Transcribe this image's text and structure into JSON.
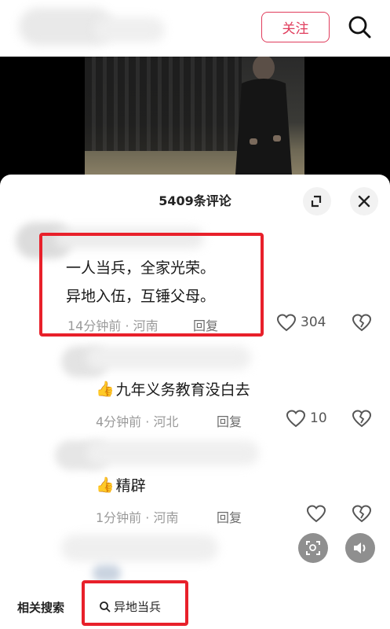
{
  "header": {
    "follow_label": "关注",
    "search_icon": "search-icon"
  },
  "comments_panel": {
    "title": "5409条评论",
    "expand_icon": "expand-icon",
    "close_icon": "close-icon"
  },
  "comments": [
    {
      "text_line1": "一人当兵，全家光荣。",
      "text_line2": "异地入伍，互锤父母。",
      "meta": "14分钟前 · 河南",
      "reply_label": "回复",
      "like_count": "304"
    },
    {
      "emoji": "👍",
      "text": "九年义务教育没白去",
      "meta": "4分钟前 · 河北",
      "reply_label": "回复",
      "like_count": "10"
    },
    {
      "emoji": "👍",
      "text": "精辟",
      "meta": "1分钟前 · 河南",
      "reply_label": "回复",
      "like_count": ""
    }
  ],
  "related_search": {
    "label": "相关搜索",
    "query": "异地当兵"
  },
  "colors": {
    "accent": "#e03c5c",
    "highlight": "#e8202a",
    "meta_gray": "#9a9a9a"
  }
}
